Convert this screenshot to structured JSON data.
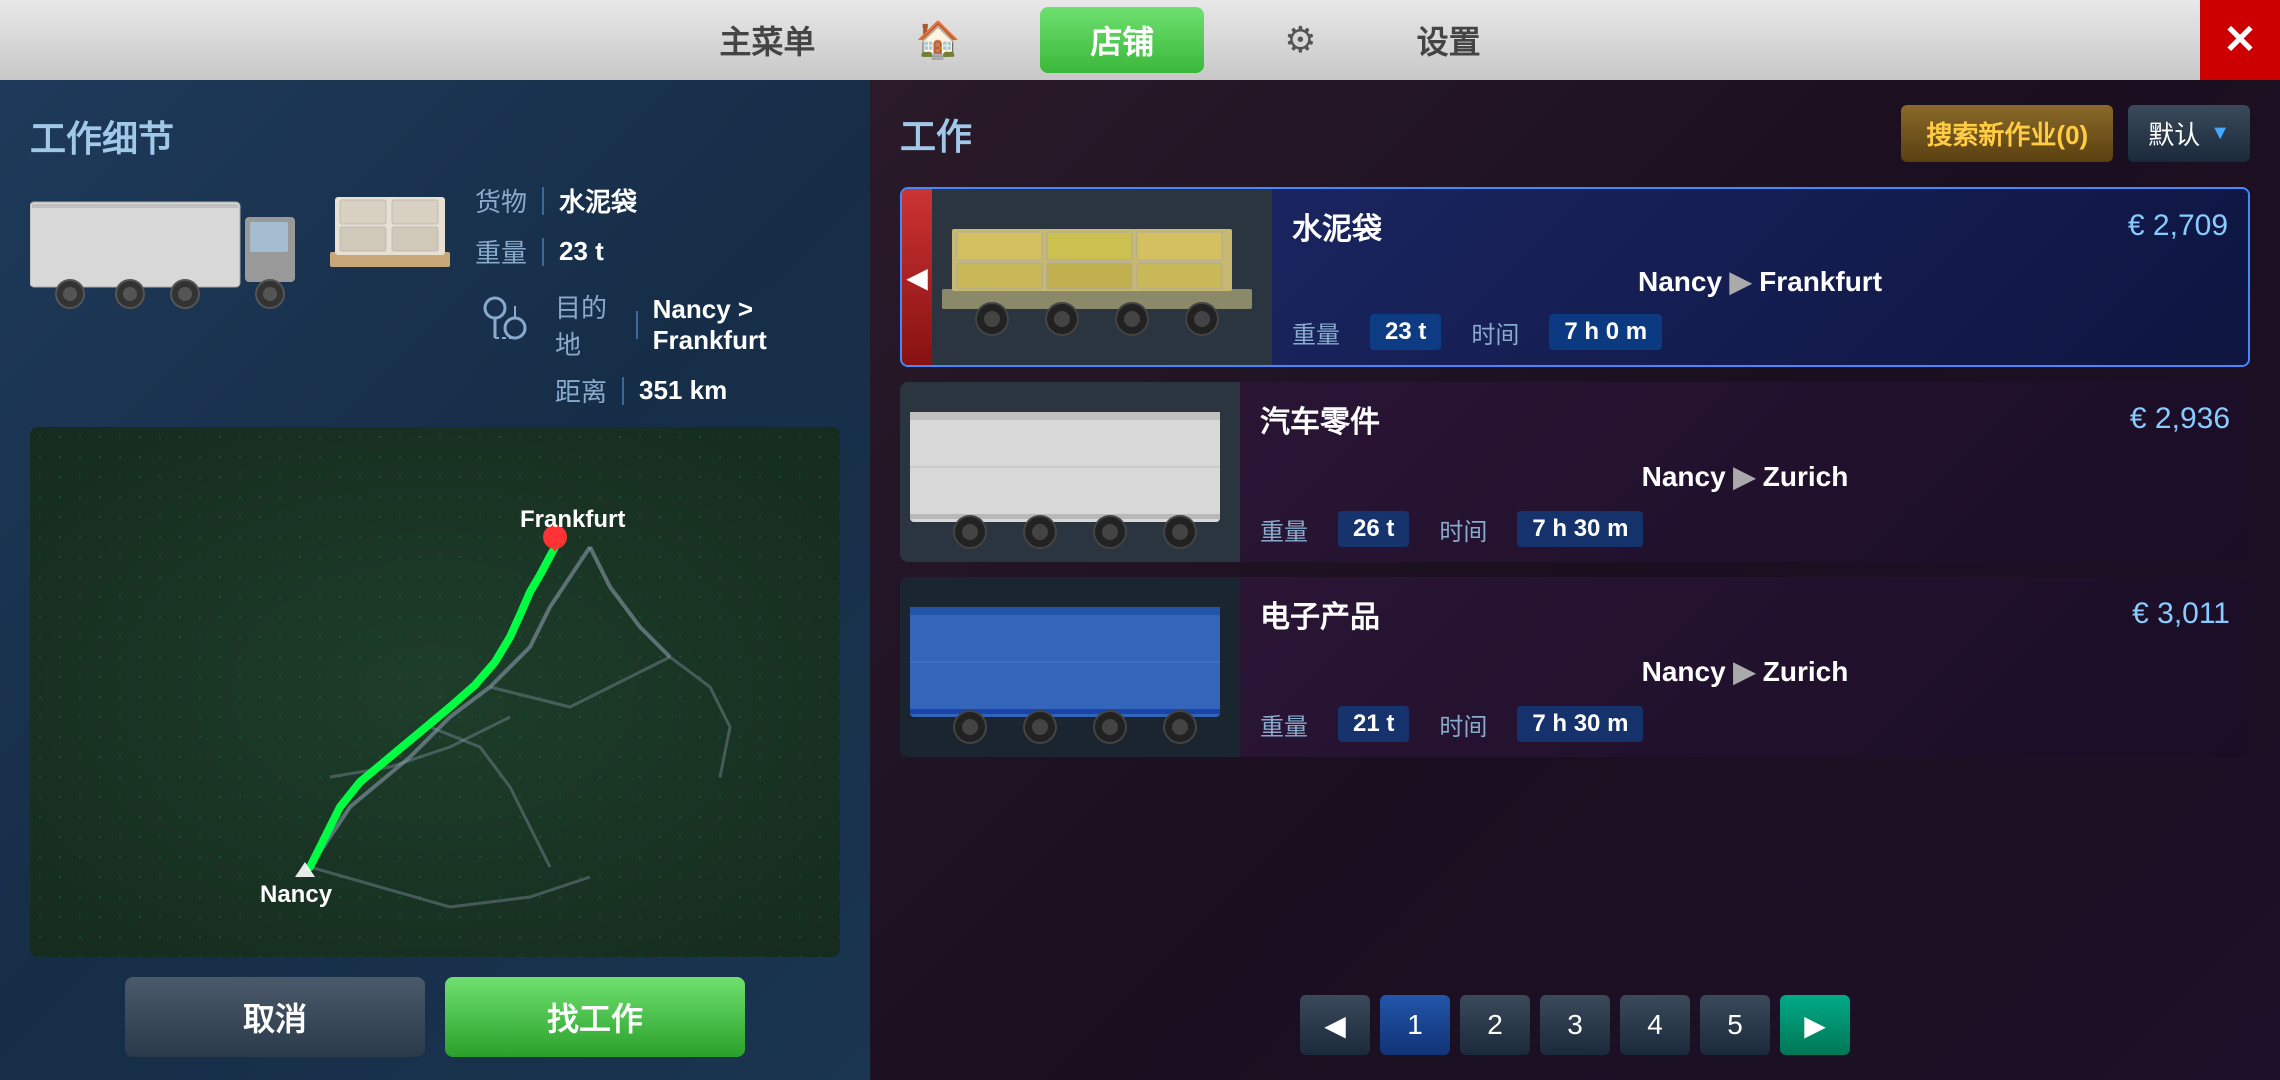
{
  "nav": {
    "main_menu": "主菜单",
    "home_icon": "🏠",
    "shop": "店铺",
    "settings_icon": "⚙",
    "settings": "设置",
    "close": "✕"
  },
  "left_panel": {
    "title": "工作细节",
    "cargo_label": "货物",
    "cargo_value": "水泥袋",
    "weight_label": "重量",
    "weight_value": "23 t",
    "destination_label": "目的地",
    "destination_value": "Nancy > Frankfurt",
    "distance_label": "距离",
    "distance_value": "351 km",
    "city_start": "Nancy",
    "city_end": "Frankfurt",
    "btn_cancel": "取消",
    "btn_find": "找工作"
  },
  "right_panel": {
    "title": "工作",
    "search_btn": "搜索新作业(0)",
    "default_btn": "默认",
    "jobs": [
      {
        "id": 1,
        "cargo": "水泥袋",
        "price": "€ 2,709",
        "from": "Nancy",
        "to": "Frankfurt",
        "weight": "23 t",
        "time": "7 h 0 m",
        "weight_label": "重量",
        "time_label": "时间",
        "selected": true,
        "trailer_type": "flatbed"
      },
      {
        "id": 2,
        "cargo": "汽车零件",
        "price": "€ 2,936",
        "from": "Nancy",
        "to": "Zurich",
        "weight": "26 t",
        "time": "7 h 30 m",
        "weight_label": "重量",
        "time_label": "时间",
        "selected": false,
        "trailer_type": "box_white"
      },
      {
        "id": 3,
        "cargo": "电子产品",
        "price": "€ 3,011",
        "from": "Nancy",
        "to": "Zurich",
        "weight": "21 t",
        "time": "7 h 30 m",
        "weight_label": "重量",
        "time_label": "时间",
        "selected": false,
        "trailer_type": "box_blue"
      }
    ],
    "pages": [
      "1",
      "2",
      "3",
      "4",
      "5"
    ]
  }
}
